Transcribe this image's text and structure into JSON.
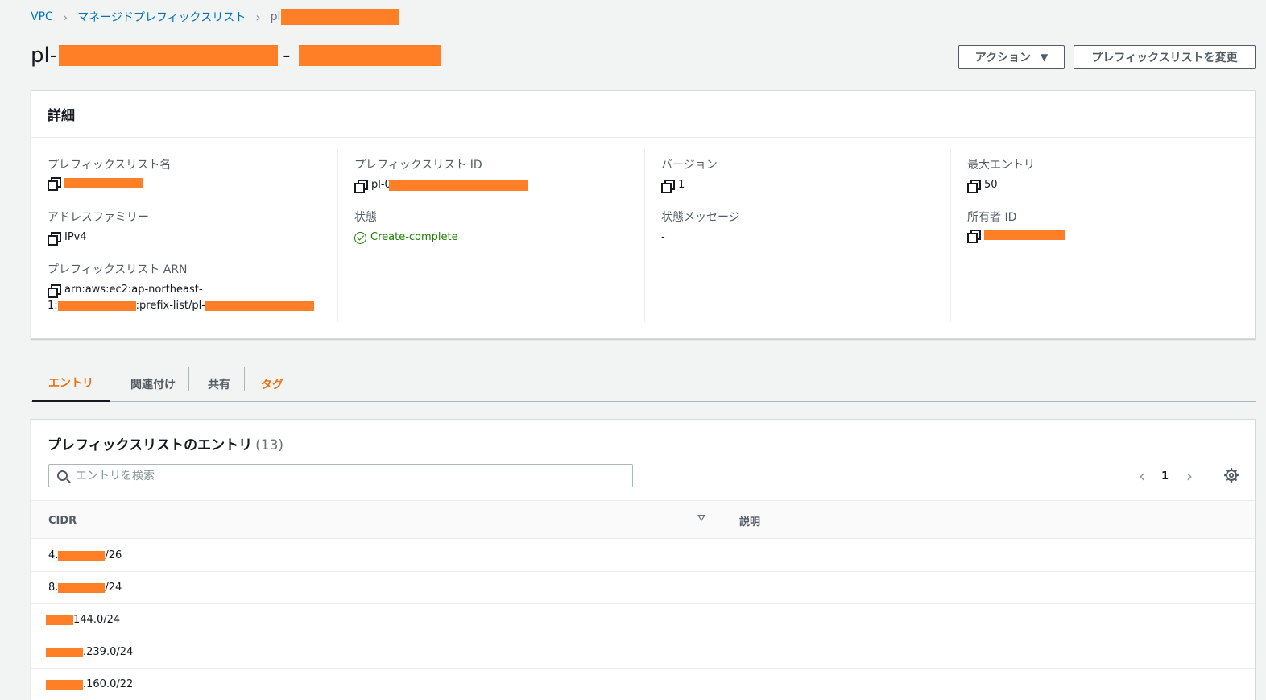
{
  "breadcrumb": {
    "items": [
      "VPC",
      "マネージドプレフィックスリスト"
    ],
    "current_prefix": "pl-"
  },
  "title": {
    "prefix": "pl-",
    "separator": "-"
  },
  "header_buttons": {
    "actions_label": "アクション",
    "modify_label": "プレフィックスリストを変更"
  },
  "details": {
    "heading": "詳細",
    "prefix_list_name_label": "プレフィックスリスト名",
    "address_family_label": "アドレスファミリー",
    "address_family_value": "IPv4",
    "arn_label": "プレフィックスリスト ARN",
    "arn_line1": "arn:aws:ec2:ap-northeast-",
    "arn_line2_prefix": "1:",
    "arn_line2_middle": ":prefix-list/pl-",
    "prefix_list_id_label": "プレフィックスリスト ID",
    "prefix_list_id_prefix": "pl-0",
    "state_label": "状態",
    "state_value": "Create-complete",
    "version_label": "バージョン",
    "version_value": "1",
    "state_message_label": "状態メッセージ",
    "state_message_value": "-",
    "max_entries_label": "最大エントリ",
    "max_entries_value": "50",
    "owner_id_label": "所有者 ID"
  },
  "tabs": [
    "エントリ",
    "関連付け",
    "共有",
    "タグ"
  ],
  "entries": {
    "title": "プレフィックスリストのエントリ",
    "count": "(13)",
    "search_placeholder": "エントリを検索",
    "page": "1",
    "columns": {
      "cidr": "CIDR",
      "description": "説明"
    },
    "rows": [
      {
        "prefix": "4.",
        "suffix": "/26"
      },
      {
        "prefix": "8.",
        "suffix": "/24"
      },
      {
        "prefix": "",
        "suffix": "144.0/24"
      },
      {
        "prefix": "",
        "suffix": ".239.0/24"
      },
      {
        "prefix": "",
        "suffix": ".160.0/22"
      }
    ]
  },
  "colors": {
    "link": "#0073bb",
    "accent": "#ec7211",
    "success": "#1d8102",
    "redaction": "#ff7f27"
  }
}
